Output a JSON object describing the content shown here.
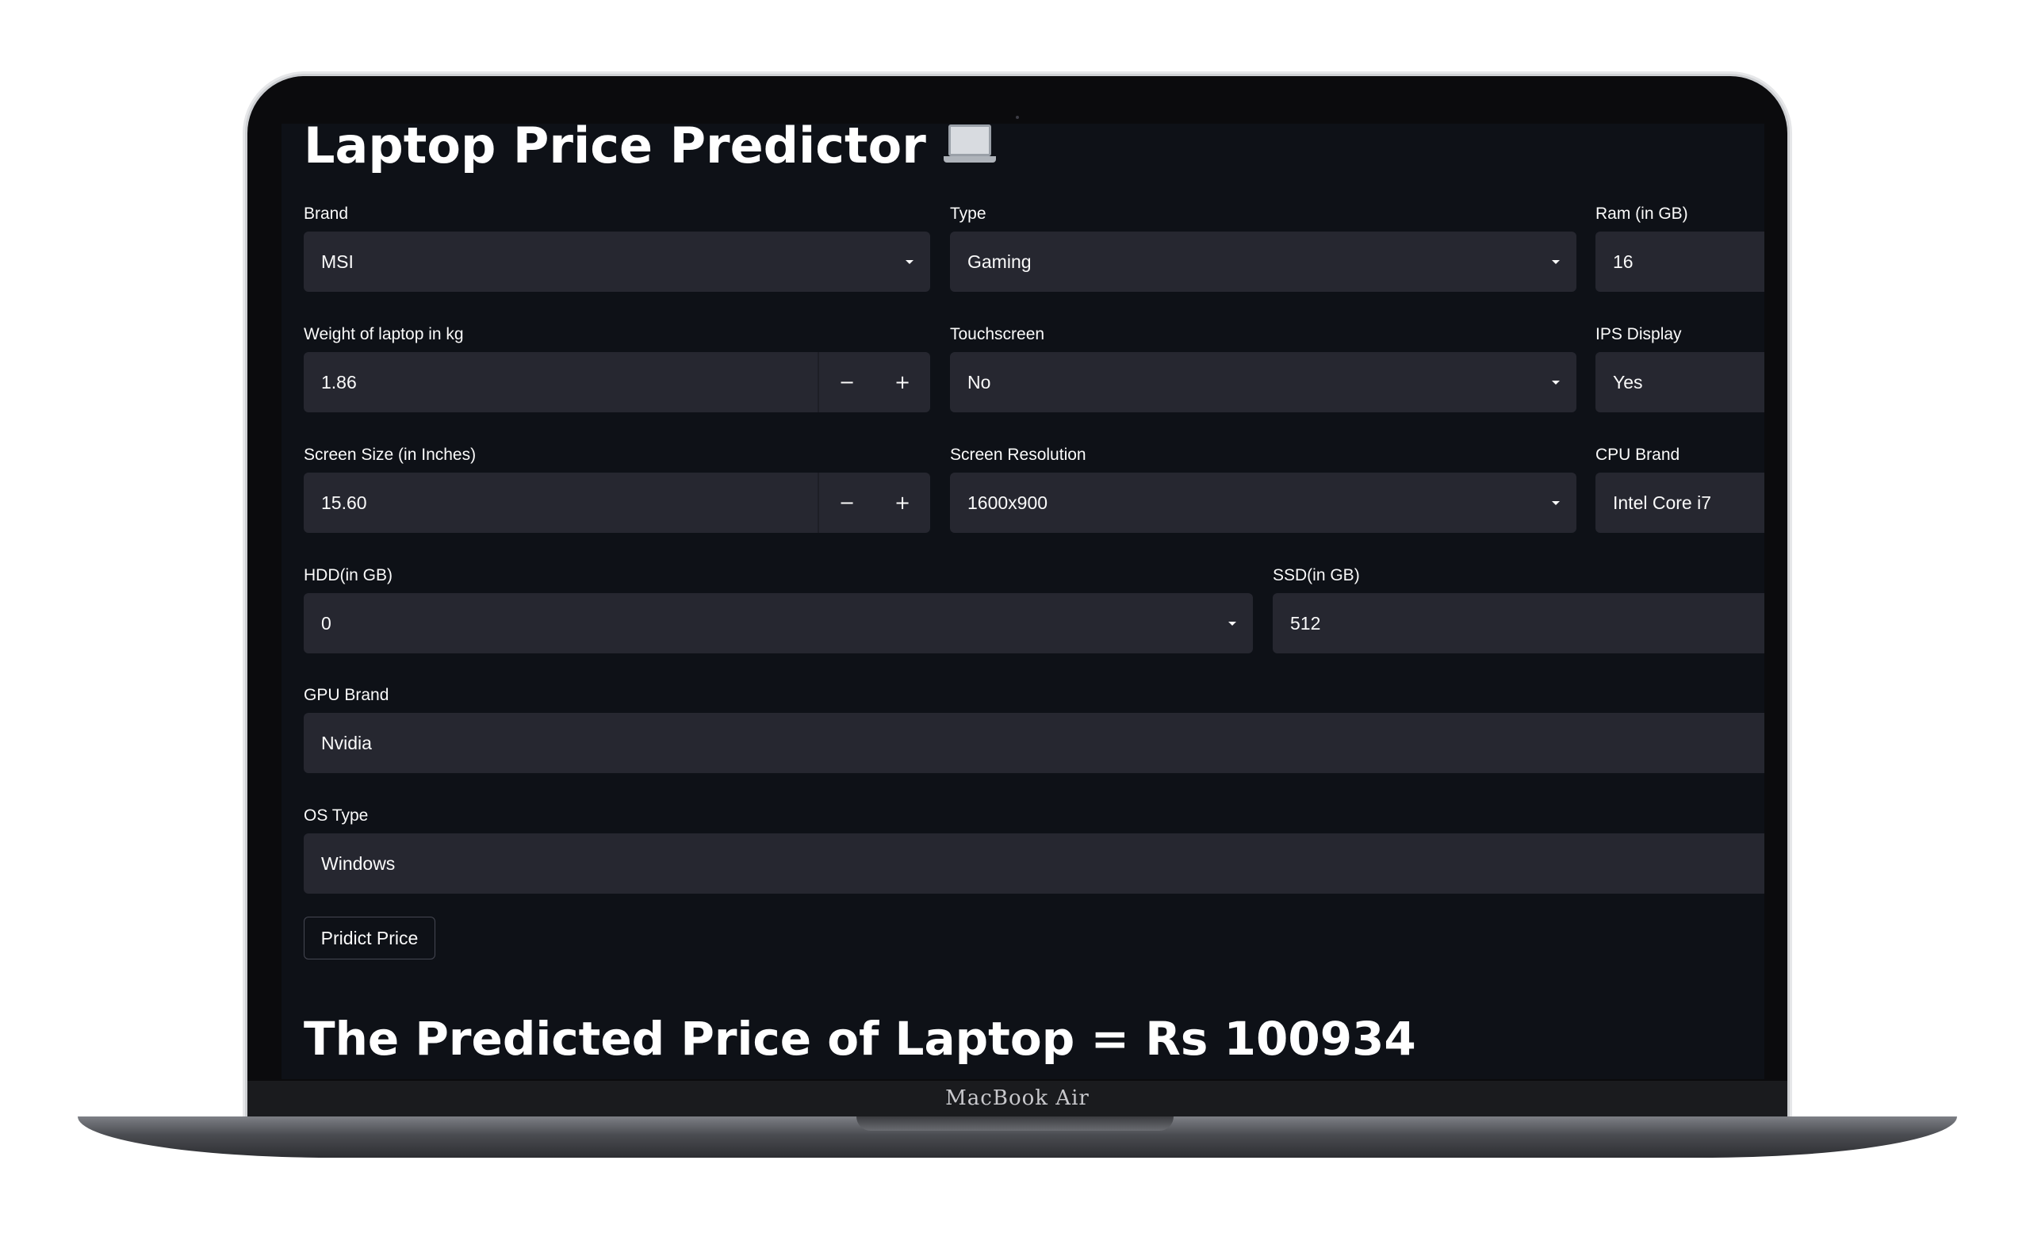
{
  "app": {
    "title": "Laptop Price Predictor",
    "title_icon": "laptop-icon"
  },
  "form": {
    "brand": {
      "label": "Brand",
      "value": "MSI",
      "control": "select"
    },
    "type": {
      "label": "Type",
      "value": "Gaming",
      "control": "select"
    },
    "ram": {
      "label": "Ram (in GB)",
      "value": "16",
      "control": "select"
    },
    "weight": {
      "label": "Weight of laptop in kg",
      "value": "1.86",
      "control": "number",
      "decrement": "−",
      "increment": "+"
    },
    "touchscreen": {
      "label": "Touchscreen",
      "value": "No",
      "control": "select"
    },
    "ips": {
      "label": "IPS Display",
      "value": "Yes",
      "control": "select"
    },
    "screen_size": {
      "label": "Screen Size (in Inches)",
      "value": "15.60",
      "control": "number",
      "decrement": "−",
      "increment": "+"
    },
    "resolution": {
      "label": "Screen Resolution",
      "value": "1600x900",
      "control": "select"
    },
    "cpu": {
      "label": "CPU Brand",
      "value": "Intel Core i7",
      "control": "select"
    },
    "hdd": {
      "label": "HDD(in GB)",
      "value": "0",
      "control": "select"
    },
    "ssd": {
      "label": "SSD(in GB)",
      "value": "512",
      "control": "select"
    },
    "gpu": {
      "label": "GPU Brand",
      "value": "Nvidia",
      "control": "select"
    },
    "os": {
      "label": "OS Type",
      "value": "Windows",
      "control": "select"
    }
  },
  "actions": {
    "predict_label": "Pridict Price"
  },
  "result": {
    "text": "The Predicted Price of Laptop = Rs 100934"
  },
  "device": {
    "model_label": "MacBook Air"
  },
  "colors": {
    "app_background": "#0e1117",
    "widget_background": "#262730",
    "text": "#fafafa"
  }
}
